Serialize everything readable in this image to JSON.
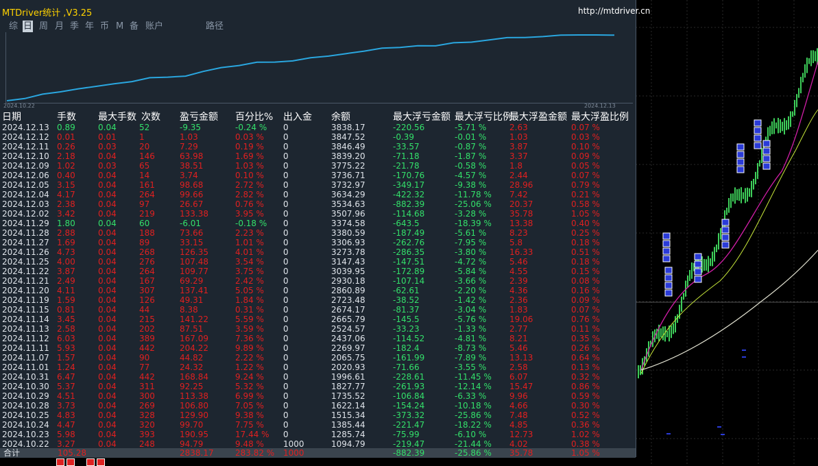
{
  "app": {
    "title": "MTDriver统计 ,V3.25",
    "url": "http://mtdriver.cn"
  },
  "tabs": [
    {
      "label": "综",
      "active": false
    },
    {
      "label": "日",
      "active": true
    },
    {
      "label": "周",
      "active": false
    },
    {
      "label": "月",
      "active": false
    },
    {
      "label": "季",
      "active": false
    },
    {
      "label": "年",
      "active": false
    },
    {
      "label": "币",
      "active": false
    },
    {
      "label": "M",
      "active": false
    },
    {
      "label": "备",
      "active": false
    },
    {
      "label": "账户",
      "active": false
    },
    {
      "label": "路径",
      "active": false
    }
  ],
  "curve": {
    "start_date": "2024.10.22",
    "end_date": "2024.12.13",
    "line_color": "#2aa7e0"
  },
  "columns": [
    "日期",
    "手数",
    "最大手数",
    "次数",
    "盈亏金额",
    "百分比%",
    "出入金",
    "余额",
    "最大浮亏金额",
    "最大浮亏比例",
    "最大浮盈金额",
    "最大浮盈比例"
  ],
  "colors": {
    "profit": "#33e06a",
    "loss": "#e02020",
    "neutral": "#dfe4ea",
    "panel_bg": "#1d2630"
  },
  "rows": [
    {
      "date": "2024.12.13",
      "lots": "0.89",
      "max_lots": "0.04",
      "count": "52",
      "pnl": "-9.35",
      "pct": "-0.24 %",
      "io": "0",
      "balance": "3838.17",
      "max_float_loss": "-220.56",
      "max_float_loss_pct": "-5.71 %",
      "max_float_profit": "2.63",
      "max_float_profit_pct": "0.07 %",
      "win": false
    },
    {
      "date": "2024.12.12",
      "lots": "0.01",
      "max_lots": "0.01",
      "count": "1",
      "pnl": "1.03",
      "pct": "0.03 %",
      "io": "0",
      "balance": "3847.52",
      "max_float_loss": "-0.39",
      "max_float_loss_pct": "-0.01 %",
      "max_float_profit": "1.03",
      "max_float_profit_pct": "0.03 %",
      "win": true
    },
    {
      "date": "2024.12.11",
      "lots": "0.26",
      "max_lots": "0.03",
      "count": "20",
      "pnl": "7.29",
      "pct": "0.19 %",
      "io": "0",
      "balance": "3846.49",
      "max_float_loss": "-33.57",
      "max_float_loss_pct": "-0.87 %",
      "max_float_profit": "3.87",
      "max_float_profit_pct": "0.10 %",
      "win": true
    },
    {
      "date": "2024.12.10",
      "lots": "2.18",
      "max_lots": "0.04",
      "count": "146",
      "pnl": "63.98",
      "pct": "1.69 %",
      "io": "0",
      "balance": "3839.20",
      "max_float_loss": "-71.18",
      "max_float_loss_pct": "-1.87 %",
      "max_float_profit": "3.37",
      "max_float_profit_pct": "0.09 %",
      "win": true
    },
    {
      "date": "2024.12.09",
      "lots": "1.02",
      "max_lots": "0.03",
      "count": "65",
      "pnl": "38.51",
      "pct": "1.03 %",
      "io": "0",
      "balance": "3775.22",
      "max_float_loss": "-21.78",
      "max_float_loss_pct": "-0.58 %",
      "max_float_profit": "1.8",
      "max_float_profit_pct": "0.05 %",
      "win": true
    },
    {
      "date": "2024.12.06",
      "lots": "0.40",
      "max_lots": "0.04",
      "count": "14",
      "pnl": "3.74",
      "pct": "0.10 %",
      "io": "0",
      "balance": "3736.71",
      "max_float_loss": "-170.76",
      "max_float_loss_pct": "-4.57 %",
      "max_float_profit": "2.44",
      "max_float_profit_pct": "0.07 %",
      "win": true
    },
    {
      "date": "2024.12.05",
      "lots": "3.15",
      "max_lots": "0.04",
      "count": "161",
      "pnl": "98.68",
      "pct": "2.72 %",
      "io": "0",
      "balance": "3732.97",
      "max_float_loss": "-349.17",
      "max_float_loss_pct": "-9.38 %",
      "max_float_profit": "28.96",
      "max_float_profit_pct": "0.79 %",
      "win": true
    },
    {
      "date": "2024.12.04",
      "lots": "4.17",
      "max_lots": "0.04",
      "count": "264",
      "pnl": "99.66",
      "pct": "2.82 %",
      "io": "0",
      "balance": "3634.29",
      "max_float_loss": "-422.32",
      "max_float_loss_pct": "-11.78 %",
      "max_float_profit": "7.42",
      "max_float_profit_pct": "0.21 %",
      "win": true
    },
    {
      "date": "2024.12.03",
      "lots": "2.38",
      "max_lots": "0.04",
      "count": "97",
      "pnl": "26.67",
      "pct": "0.76 %",
      "io": "0",
      "balance": "3534.63",
      "max_float_loss": "-882.39",
      "max_float_loss_pct": "-25.06 %",
      "max_float_profit": "20.37",
      "max_float_profit_pct": "0.58 %",
      "win": true
    },
    {
      "date": "2024.12.02",
      "lots": "3.42",
      "max_lots": "0.04",
      "count": "219",
      "pnl": "133.38",
      "pct": "3.95 %",
      "io": "0",
      "balance": "3507.96",
      "max_float_loss": "-114.68",
      "max_float_loss_pct": "-3.28 %",
      "max_float_profit": "35.78",
      "max_float_profit_pct": "1.05 %",
      "win": true
    },
    {
      "date": "2024.11.29",
      "lots": "1.80",
      "max_lots": "0.04",
      "count": "60",
      "pnl": "-6.01",
      "pct": "-0.18 %",
      "io": "0",
      "balance": "3374.58",
      "max_float_loss": "-643.5",
      "max_float_loss_pct": "-18.39 %",
      "max_float_profit": "13.38",
      "max_float_profit_pct": "0.40 %",
      "win": false
    },
    {
      "date": "2024.11.28",
      "lots": "2.88",
      "max_lots": "0.04",
      "count": "188",
      "pnl": "73.66",
      "pct": "2.23 %",
      "io": "0",
      "balance": "3380.59",
      "max_float_loss": "-187.49",
      "max_float_loss_pct": "-5.61 %",
      "max_float_profit": "8.23",
      "max_float_profit_pct": "0.25 %",
      "win": true
    },
    {
      "date": "2024.11.27",
      "lots": "1.69",
      "max_lots": "0.04",
      "count": "89",
      "pnl": "33.15",
      "pct": "1.01 %",
      "io": "0",
      "balance": "3306.93",
      "max_float_loss": "-262.76",
      "max_float_loss_pct": "-7.95 %",
      "max_float_profit": "5.8",
      "max_float_profit_pct": "0.18 %",
      "win": true
    },
    {
      "date": "2024.11.26",
      "lots": "4.73",
      "max_lots": "0.04",
      "count": "268",
      "pnl": "126.35",
      "pct": "4.01 %",
      "io": "0",
      "balance": "3273.78",
      "max_float_loss": "-286.35",
      "max_float_loss_pct": "-3.80 %",
      "max_float_profit": "16.33",
      "max_float_profit_pct": "0.51 %",
      "win": true
    },
    {
      "date": "2024.11.25",
      "lots": "4.00",
      "max_lots": "0.04",
      "count": "276",
      "pnl": "107.48",
      "pct": "3.54 %",
      "io": "0",
      "balance": "3147.43",
      "max_float_loss": "-147.51",
      "max_float_loss_pct": "-4.72 %",
      "max_float_profit": "5.46",
      "max_float_profit_pct": "0.18 %",
      "win": true
    },
    {
      "date": "2024.11.22",
      "lots": "3.87",
      "max_lots": "0.04",
      "count": "264",
      "pnl": "109.77",
      "pct": "3.75 %",
      "io": "0",
      "balance": "3039.95",
      "max_float_loss": "-172.89",
      "max_float_loss_pct": "-5.84 %",
      "max_float_profit": "4.55",
      "max_float_profit_pct": "0.15 %",
      "win": true
    },
    {
      "date": "2024.11.21",
      "lots": "2.49",
      "max_lots": "0.04",
      "count": "167",
      "pnl": "69.29",
      "pct": "2.42 %",
      "io": "0",
      "balance": "2930.18",
      "max_float_loss": "-107.14",
      "max_float_loss_pct": "-3.66 %",
      "max_float_profit": "2.39",
      "max_float_profit_pct": "0.08 %",
      "win": true
    },
    {
      "date": "2024.11.20",
      "lots": "4.11",
      "max_lots": "0.04",
      "count": "307",
      "pnl": "137.41",
      "pct": "5.05 %",
      "io": "0",
      "balance": "2860.89",
      "max_float_loss": "-62.61",
      "max_float_loss_pct": "-2.20 %",
      "max_float_profit": "4.36",
      "max_float_profit_pct": "0.16 %",
      "win": true
    },
    {
      "date": "2024.11.19",
      "lots": "1.59",
      "max_lots": "0.04",
      "count": "126",
      "pnl": "49.31",
      "pct": "1.84 %",
      "io": "0",
      "balance": "2723.48",
      "max_float_loss": "-38.52",
      "max_float_loss_pct": "-1.42 %",
      "max_float_profit": "2.36",
      "max_float_profit_pct": "0.09 %",
      "win": true
    },
    {
      "date": "2024.11.15",
      "lots": "0.81",
      "max_lots": "0.04",
      "count": "44",
      "pnl": "8.38",
      "pct": "0.31 %",
      "io": "0",
      "balance": "2674.17",
      "max_float_loss": "-81.37",
      "max_float_loss_pct": "-3.04 %",
      "max_float_profit": "1.83",
      "max_float_profit_pct": "0.07 %",
      "win": true
    },
    {
      "date": "2024.11.14",
      "lots": "3.45",
      "max_lots": "0.04",
      "count": "215",
      "pnl": "141.22",
      "pct": "5.59 %",
      "io": "0",
      "balance": "2665.79",
      "max_float_loss": "-145.5",
      "max_float_loss_pct": "-5.76 %",
      "max_float_profit": "19.06",
      "max_float_profit_pct": "0.76 %",
      "win": true
    },
    {
      "date": "2024.11.13",
      "lots": "2.58",
      "max_lots": "0.04",
      "count": "202",
      "pnl": "87.51",
      "pct": "3.59 %",
      "io": "0",
      "balance": "2524.57",
      "max_float_loss": "-33.23",
      "max_float_loss_pct": "-1.33 %",
      "max_float_profit": "2.77",
      "max_float_profit_pct": "0.11 %",
      "win": true
    },
    {
      "date": "2024.11.12",
      "lots": "6.03",
      "max_lots": "0.04",
      "count": "389",
      "pnl": "167.09",
      "pct": "7.36 %",
      "io": "0",
      "balance": "2437.06",
      "max_float_loss": "-114.52",
      "max_float_loss_pct": "-4.81 %",
      "max_float_profit": "8.21",
      "max_float_profit_pct": "0.35 %",
      "win": true
    },
    {
      "date": "2024.11.11",
      "lots": "5.93",
      "max_lots": "0.04",
      "count": "442",
      "pnl": "204.22",
      "pct": "9.89 %",
      "io": "0",
      "balance": "2269.97",
      "max_float_loss": "-182.4",
      "max_float_loss_pct": "-8.73 %",
      "max_float_profit": "5.46",
      "max_float_profit_pct": "0.26 %",
      "win": true
    },
    {
      "date": "2024.11.07",
      "lots": "1.57",
      "max_lots": "0.04",
      "count": "90",
      "pnl": "44.82",
      "pct": "2.22 %",
      "io": "0",
      "balance": "2065.75",
      "max_float_loss": "-161.99",
      "max_float_loss_pct": "-7.89 %",
      "max_float_profit": "13.13",
      "max_float_profit_pct": "0.64 %",
      "win": true
    },
    {
      "date": "2024.11.01",
      "lots": "1.24",
      "max_lots": "0.04",
      "count": "77",
      "pnl": "24.32",
      "pct": "1.22 %",
      "io": "0",
      "balance": "2020.93",
      "max_float_loss": "-71.66",
      "max_float_loss_pct": "-3.55 %",
      "max_float_profit": "2.58",
      "max_float_profit_pct": "0.13 %",
      "win": true
    },
    {
      "date": "2024.10.31",
      "lots": "6.47",
      "max_lots": "0.04",
      "count": "442",
      "pnl": "168.84",
      "pct": "9.24 %",
      "io": "0",
      "balance": "1996.61",
      "max_float_loss": "-228.61",
      "max_float_loss_pct": "-11.45 %",
      "max_float_profit": "6.07",
      "max_float_profit_pct": "0.32 %",
      "win": true
    },
    {
      "date": "2024.10.30",
      "lots": "5.37",
      "max_lots": "0.04",
      "count": "311",
      "pnl": "92.25",
      "pct": "5.32 %",
      "io": "0",
      "balance": "1827.77",
      "max_float_loss": "-261.93",
      "max_float_loss_pct": "-12.14 %",
      "max_float_profit": "15.47",
      "max_float_profit_pct": "0.86 %",
      "win": true
    },
    {
      "date": "2024.10.29",
      "lots": "4.51",
      "max_lots": "0.04",
      "count": "300",
      "pnl": "113.38",
      "pct": "6.99 %",
      "io": "0",
      "balance": "1735.52",
      "max_float_loss": "-106.84",
      "max_float_loss_pct": "-6.33 %",
      "max_float_profit": "9.96",
      "max_float_profit_pct": "0.59 %",
      "win": true
    },
    {
      "date": "2024.10.28",
      "lots": "3.73",
      "max_lots": "0.04",
      "count": "269",
      "pnl": "106.80",
      "pct": "7.05 %",
      "io": "0",
      "balance": "1622.14",
      "max_float_loss": "-154.24",
      "max_float_loss_pct": "-10.18 %",
      "max_float_profit": "4.66",
      "max_float_profit_pct": "0.30 %",
      "win": true
    },
    {
      "date": "2024.10.25",
      "lots": "4.83",
      "max_lots": "0.04",
      "count": "328",
      "pnl": "129.90",
      "pct": "9.38 %",
      "io": "0",
      "balance": "1515.34",
      "max_float_loss": "-373.32",
      "max_float_loss_pct": "-25.86 %",
      "max_float_profit": "7.48",
      "max_float_profit_pct": "0.52 %",
      "win": true
    },
    {
      "date": "2024.10.24",
      "lots": "4.47",
      "max_lots": "0.04",
      "count": "320",
      "pnl": "99.70",
      "pct": "7.75 %",
      "io": "0",
      "balance": "1385.44",
      "max_float_loss": "-221.47",
      "max_float_loss_pct": "-18.22 %",
      "max_float_profit": "4.85",
      "max_float_profit_pct": "0.36 %",
      "win": true
    },
    {
      "date": "2024.10.23",
      "lots": "5.98",
      "max_lots": "0.04",
      "count": "393",
      "pnl": "190.95",
      "pct": "17.44 %",
      "io": "0",
      "balance": "1285.74",
      "max_float_loss": "-75.99",
      "max_float_loss_pct": "-6.10 %",
      "max_float_profit": "12.73",
      "max_float_profit_pct": "1.02 %",
      "win": true
    },
    {
      "date": "2024.10.22",
      "lots": "3.27",
      "max_lots": "0.04",
      "count": "248",
      "pnl": "94.79",
      "pct": "9.48 %",
      "io": "1000",
      "balance": "1094.79",
      "max_float_loss": "-219.47",
      "max_float_loss_pct": "-21.44 %",
      "max_float_profit": "4.02",
      "max_float_profit_pct": "0.38 %",
      "win": true
    }
  ],
  "total": {
    "label": "合计",
    "lots": "105.28",
    "pnl": "2838.17",
    "pct": "283.82 %",
    "io": "1000",
    "max_float_loss": "-882.39",
    "max_float_loss_pct": "-25.86 %",
    "max_float_profit": "35.78",
    "max_float_profit_pct": "1.05 %"
  }
}
